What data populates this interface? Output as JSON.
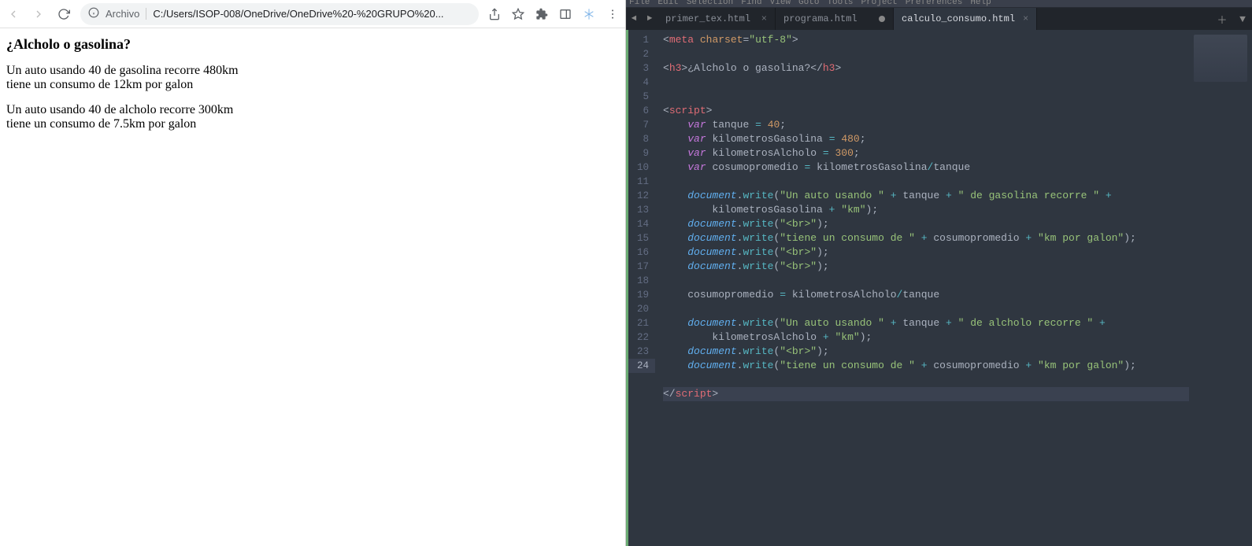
{
  "browser": {
    "address_label": "Archivo",
    "url": "C:/Users/ISOP-008/OneDrive/OneDrive%20-%20GRUPO%20...",
    "page": {
      "heading": "¿Alcholo o gasolina?",
      "line1": "Un auto usando 40 de gasolina recorre 480km",
      "line2": "tiene un consumo de 12km por galon",
      "line3": "Un auto usando 40 de alcholo recorre 300km",
      "line4": "tiene un consumo de 7.5km por galon"
    }
  },
  "editor": {
    "menu_items": [
      "File",
      "Edit",
      "Selection",
      "Find",
      "View",
      "Goto",
      "Tools",
      "Project",
      "Preferences",
      "Help"
    ],
    "tabs": [
      {
        "label": "primer_tex.html",
        "active": false,
        "dirty": false
      },
      {
        "label": "programa.html",
        "active": false,
        "dirty": true
      },
      {
        "label": "calculo_consumo.html",
        "active": true,
        "dirty": false
      }
    ],
    "active_line": 24,
    "code": {
      "l1": {
        "tag_open": "<",
        "tag": "meta",
        "attr1": "charset",
        "eq": "=",
        "val1": "\"utf-8\"",
        "tag_close": ">"
      },
      "l3": {
        "open": "<",
        "tag": "h3",
        "close": ">",
        "text": "¿Alcholo o gasolina?",
        "open2": "</",
        "close2": ">"
      },
      "l6": {
        "open": "<",
        "tag": "script",
        "close": ">"
      },
      "l7": {
        "kw": "var",
        "name": "tanque",
        "op": "=",
        "num": "40",
        "semi": ";"
      },
      "l8": {
        "kw": "var",
        "name": "kilometrosGasolina",
        "op": "=",
        "num": "480",
        "semi": ";"
      },
      "l9": {
        "kw": "var",
        "name": "kilometrosAlcholo",
        "op": "=",
        "num": "300",
        "semi": ";"
      },
      "l10": {
        "kw": "var",
        "name": "cosumopromedio",
        "op": "=",
        "rhs1": "kilometrosGasolina",
        "div": "/",
        "rhs2": "tanque"
      },
      "l12": {
        "obj": "document",
        "dot": ".",
        "fn": "write",
        "lp": "(",
        "s1": "\"Un auto usando \"",
        "plus1": "+",
        "v1": "tanque",
        "plus2": "+",
        "s2": "\" de gasolina recorre \"",
        "plus3": "+",
        "cont_indent": "        ",
        "v2": "kilometrosGasolina",
        "plus4": "+",
        "s3": "\"km\"",
        "rp": ")",
        "semi": ";"
      },
      "l13": {
        "obj": "document",
        "dot": ".",
        "fn": "write",
        "lp": "(",
        "s1": "\"<br>\"",
        "rp": ")",
        "semi": ";"
      },
      "l14": {
        "obj": "document",
        "dot": ".",
        "fn": "write",
        "lp": "(",
        "s1": "\"tiene un consumo de \"",
        "plus1": "+",
        "v1": "cosumopromedio",
        "plus2": "+",
        "s2": "\"km por galon\"",
        "rp": ")",
        "semi": ";"
      },
      "l15": {
        "obj": "document",
        "dot": ".",
        "fn": "write",
        "lp": "(",
        "s1": "\"<br>\"",
        "rp": ")",
        "semi": ";"
      },
      "l16": {
        "obj": "document",
        "dot": ".",
        "fn": "write",
        "lp": "(",
        "s1": "\"<br>\"",
        "rp": ")",
        "semi": ";"
      },
      "l18": {
        "name": "cosumopromedio",
        "op": "=",
        "rhs1": "kilometrosAlcholo",
        "div": "/",
        "rhs2": "tanque"
      },
      "l20": {
        "obj": "document",
        "dot": ".",
        "fn": "write",
        "lp": "(",
        "s1": "\"Un auto usando \"",
        "plus1": "+",
        "v1": "tanque",
        "plus2": "+",
        "s2": "\" de alcholo recorre \"",
        "plus3": "+",
        "cont_indent": "        ",
        "v2": "kilometrosAlcholo",
        "plus4": "+",
        "s3": "\"km\"",
        "rp": ")",
        "semi": ";"
      },
      "l21": {
        "obj": "document",
        "dot": ".",
        "fn": "write",
        "lp": "(",
        "s1": "\"<br>\"",
        "rp": ")",
        "semi": ";"
      },
      "l22": {
        "obj": "document",
        "dot": ".",
        "fn": "write",
        "lp": "(",
        "s1": "\"tiene un consumo de \"",
        "plus1": "+",
        "v1": "cosumopromedio",
        "plus2": "+",
        "s2": "\"km por galon\"",
        "rp": ")",
        "semi": ";"
      },
      "l24": {
        "open": "</",
        "tag": "script",
        "close": ">"
      }
    }
  }
}
